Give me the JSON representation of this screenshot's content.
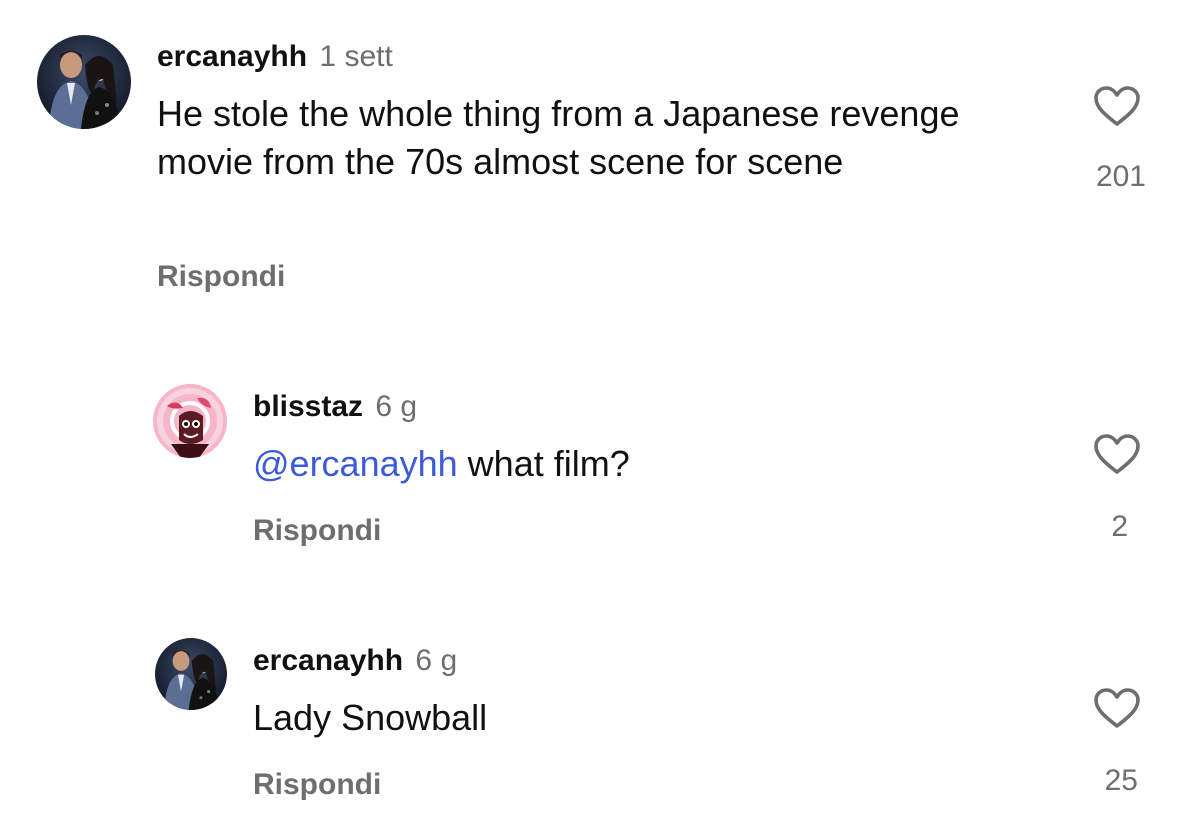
{
  "comments": [
    {
      "username": "ercanayhh",
      "time": "1 sett",
      "text": "He stole the whole thing from a Japanese revenge movie from the 70s almost scene for scene",
      "reply_label": "Rispondi",
      "like_count": "201",
      "avatar_icon": "profile-photo-two-people"
    },
    {
      "username": "blisstaz",
      "time": "6 g",
      "mention": "@ercanayhh",
      "text": " what film?",
      "reply_label": "Rispondi",
      "like_count": "2",
      "avatar_icon": "profile-illustration-pink"
    },
    {
      "username": "ercanayhh",
      "time": "6 g",
      "text": "Lady Snowball",
      "reply_label": "Rispondi",
      "like_count": "25",
      "avatar_icon": "profile-photo-two-people"
    }
  ],
  "colors": {
    "mention": "#3b5bdb",
    "secondary_text": "#6e6e6e",
    "primary_text": "#111111"
  }
}
